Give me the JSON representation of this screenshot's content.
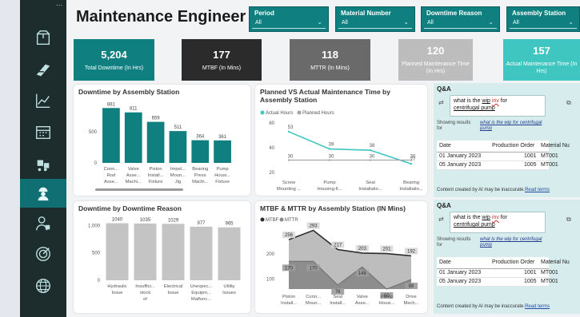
{
  "title": "Maintenance Engineer",
  "slicers": [
    {
      "label": "Period",
      "value": "All"
    },
    {
      "label": "Material Number",
      "value": "All"
    },
    {
      "label": "Downtime Reason",
      "value": "All"
    },
    {
      "label": "Assembly Station",
      "value": "All"
    }
  ],
  "kpis": [
    {
      "value": "5,204",
      "caption": "Total Downtime (In Hrs)",
      "color": "#0f7f80"
    },
    {
      "value": "177",
      "caption": "MTBF (In Mins)",
      "color": "#2b2b2b"
    },
    {
      "value": "118",
      "caption": "MTTR (In Mins)",
      "color": "#6a6a6a"
    },
    {
      "value": "120",
      "caption": "Planned Maintenance Time (In Hrs)",
      "color": "#bdbdbd"
    },
    {
      "value": "157",
      "caption": "Actual Maintenance Time (In Hrs)",
      "color": "#3fc6c0"
    }
  ],
  "chart_titles": {
    "c1": "Downtime by Assembly Station",
    "c2": "Planned VS Actual Maintenance Time by Assembly Station",
    "c3": "Downtime by Downtime Reason",
    "c4": "MTBF & MTTR by Assembly Station (IN Mins)"
  },
  "chart_data": [
    {
      "type": "bar",
      "title": "Downtime by Assembly Station",
      "categories": [
        "Conn... Rod Asse...",
        "Valve Asse... Machi...",
        "Piston Install... Fixture",
        "Impel... Moun... Jig",
        "Bearing Press Machi...",
        "Pump Housi... Fixture"
      ],
      "values": [
        881,
        811,
        659,
        511,
        364,
        361
      ],
      "yticks": [
        "0",
        "500"
      ],
      "ylim": [
        0,
        1000
      ],
      "color": "#0f7f80"
    },
    {
      "type": "line",
      "title": "Planned VS Actual Maintenance Time by Assembly Station",
      "legend": [
        "Actual Hours",
        "Planned Hours"
      ],
      "categories": [
        "Screw Mounting ...",
        "Pump Housing-F...",
        "Seal Installatio...",
        "Bearing Installatio..."
      ],
      "series": [
        {
          "name": "Actual Hours",
          "values": [
            53,
            39,
            38,
            27
          ],
          "color": "#3fc6c0"
        },
        {
          "name": "Planned Hours",
          "values": [
            30,
            30,
            30,
            30
          ],
          "color": "#a6a6a6"
        }
      ],
      "yticks": [
        "20",
        "40",
        "60"
      ],
      "ylim": [
        20,
        62
      ]
    },
    {
      "type": "bar",
      "title": "Downtime by Downtime Reason",
      "categories": [
        "Hydraulic Issue",
        "Insuffici... stock of critical s...",
        "Electrical Issue",
        "Unexpec... Equipm... Malfunc...",
        "Utility Issues"
      ],
      "values": [
        1040,
        1035,
        1029,
        977,
        965
      ],
      "yticks": [
        "0",
        "500",
        "1,000"
      ],
      "ylim": [
        0,
        1150
      ],
      "color": "#c4c4c4"
    },
    {
      "type": "area",
      "title": "MTBF & MTTR by Assembly Station (IN Mins)",
      "legend": [
        "MTBF",
        "MTTR"
      ],
      "categories": [
        "Piston Install...",
        "Conn... Moun...",
        "Seal Install...",
        "Valve Asse...",
        "Pump Housi...",
        "Drive Mech..."
      ],
      "series": [
        {
          "name": "MTBF",
          "values": [
            256,
            293,
            217,
            203,
            201,
            192
          ],
          "color": "#2b2b2b"
        },
        {
          "name": "MTTR",
          "values": [
            170,
            170,
            76,
            148,
            60,
            98
          ],
          "color": "#8a8a8a"
        }
      ],
      "yticks": [
        "100",
        "200"
      ],
      "ylim": [
        60,
        320
      ]
    }
  ],
  "qa": [
    {
      "header": "Q&A",
      "question_pre": "what is the ",
      "question_u1": "wip",
      "question_red": "inv",
      "question_post": " for",
      "question_u2": "centrifugal pump",
      "showing": "Showing results for",
      "showing_link": "what is the wip for centrifugal pump",
      "columns": [
        "Date",
        "Production Order",
        "Material Nu"
      ],
      "rows": [
        [
          "01 January 2023",
          "1001",
          "MT001"
        ],
        [
          "05 January 2023",
          "1005",
          "MT001"
        ]
      ],
      "footer": "Content created by AI may be inaccurate.",
      "footer_link": "Read terms"
    },
    {
      "header": "Q&A",
      "question_pre": "what is the ",
      "question_u1": "wip",
      "question_red": "inv",
      "question_post": " for",
      "question_u2": "centrifugal pump",
      "showing": "Showing results for",
      "showing_link": "what is the wip for centrifugal pump",
      "columns": [
        "Date",
        "Production Order",
        "Material Nu"
      ],
      "rows": [
        [
          "01 January 2023",
          "1001",
          "MT001"
        ],
        [
          "05 January 2023",
          "1005",
          "MT001"
        ]
      ],
      "footer": "Content created by AI may be inaccurate.",
      "footer_link": "Read terms"
    }
  ],
  "nav_icons": [
    "package-icon",
    "parts-icon",
    "trend-chart-icon",
    "calendar-icon",
    "forklift-icon",
    "engineer-icon",
    "operator-icon",
    "target-icon",
    "globe-icon"
  ],
  "dots": "⋯"
}
